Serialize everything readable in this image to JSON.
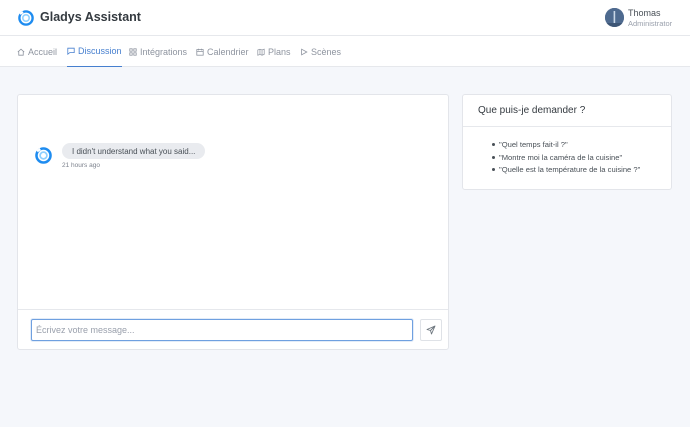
{
  "app": {
    "title": "Gladys Assistant"
  },
  "user": {
    "name": "Thomas",
    "role": "Administrator"
  },
  "nav": {
    "items": [
      {
        "label": "Accueil",
        "icon": "home-icon",
        "active": false
      },
      {
        "label": "Discussion",
        "icon": "message-square-icon",
        "active": true
      },
      {
        "label": "Intégrations",
        "icon": "grid-icon",
        "active": false
      },
      {
        "label": "Calendrier",
        "icon": "calendar-icon",
        "active": false
      },
      {
        "label": "Plans",
        "icon": "map-icon",
        "active": false
      },
      {
        "label": "Scènes",
        "icon": "play-icon",
        "active": false
      }
    ]
  },
  "chat": {
    "messages": [
      {
        "text": "I didn't understand what you said...",
        "time": "21 hours ago",
        "from": "bot"
      }
    ],
    "input": {
      "placeholder": "Écrivez votre message...",
      "value": ""
    },
    "send_icon": "send-icon"
  },
  "help": {
    "title": "Que puis-je demander ?",
    "examples": [
      "\"Quel temps fait-il ?\"",
      "\"Montre moi la caméra de la cuisine\"",
      "\"Quelle est la température de la cuisine ?\""
    ]
  },
  "colors": {
    "accent": "#467fcf",
    "background": "#f5f7fb",
    "logo": "#1e8cf0"
  }
}
